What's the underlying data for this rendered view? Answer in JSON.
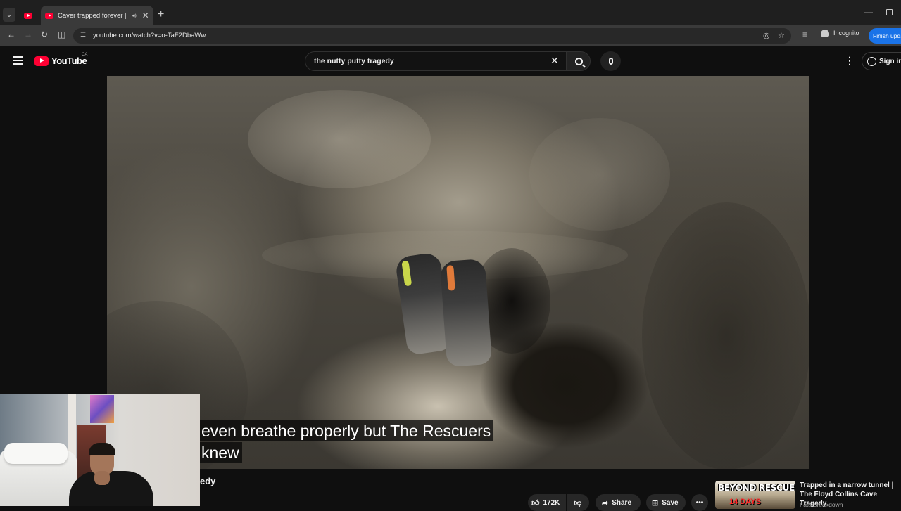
{
  "browser": {
    "tab_title": "Caver trapped forever | The",
    "new_tab_symbol": "+",
    "url": "youtube.com/watch?v=o-TaF2DbaWw",
    "incognito_label": "Incognito",
    "finish_update_label": "Finish update"
  },
  "youtube": {
    "logo_text": "YouTube",
    "country_code": "CA",
    "search_query": "the nutty putty tragedy",
    "sign_in_label": "Sign in"
  },
  "video": {
    "caption_line1": "even breathe properly but The Rescuers",
    "caption_line2": "knew",
    "title_fragment": "edy"
  },
  "actions": {
    "like_count": "172K",
    "share_label": "Share",
    "save_label": "Save"
  },
  "recommended": {
    "thumb_text1": "BEYOND RESCUE",
    "thumb_text2": "14 DAYS",
    "title": "Trapped in a narrow tunnel | The Floyd Collins Cave Tragedy",
    "channel": "FatalBreakdown"
  },
  "colors": {
    "brand_red": "#ff0033",
    "accent_blue": "#1a73e8",
    "background": "#0f0f0f"
  }
}
